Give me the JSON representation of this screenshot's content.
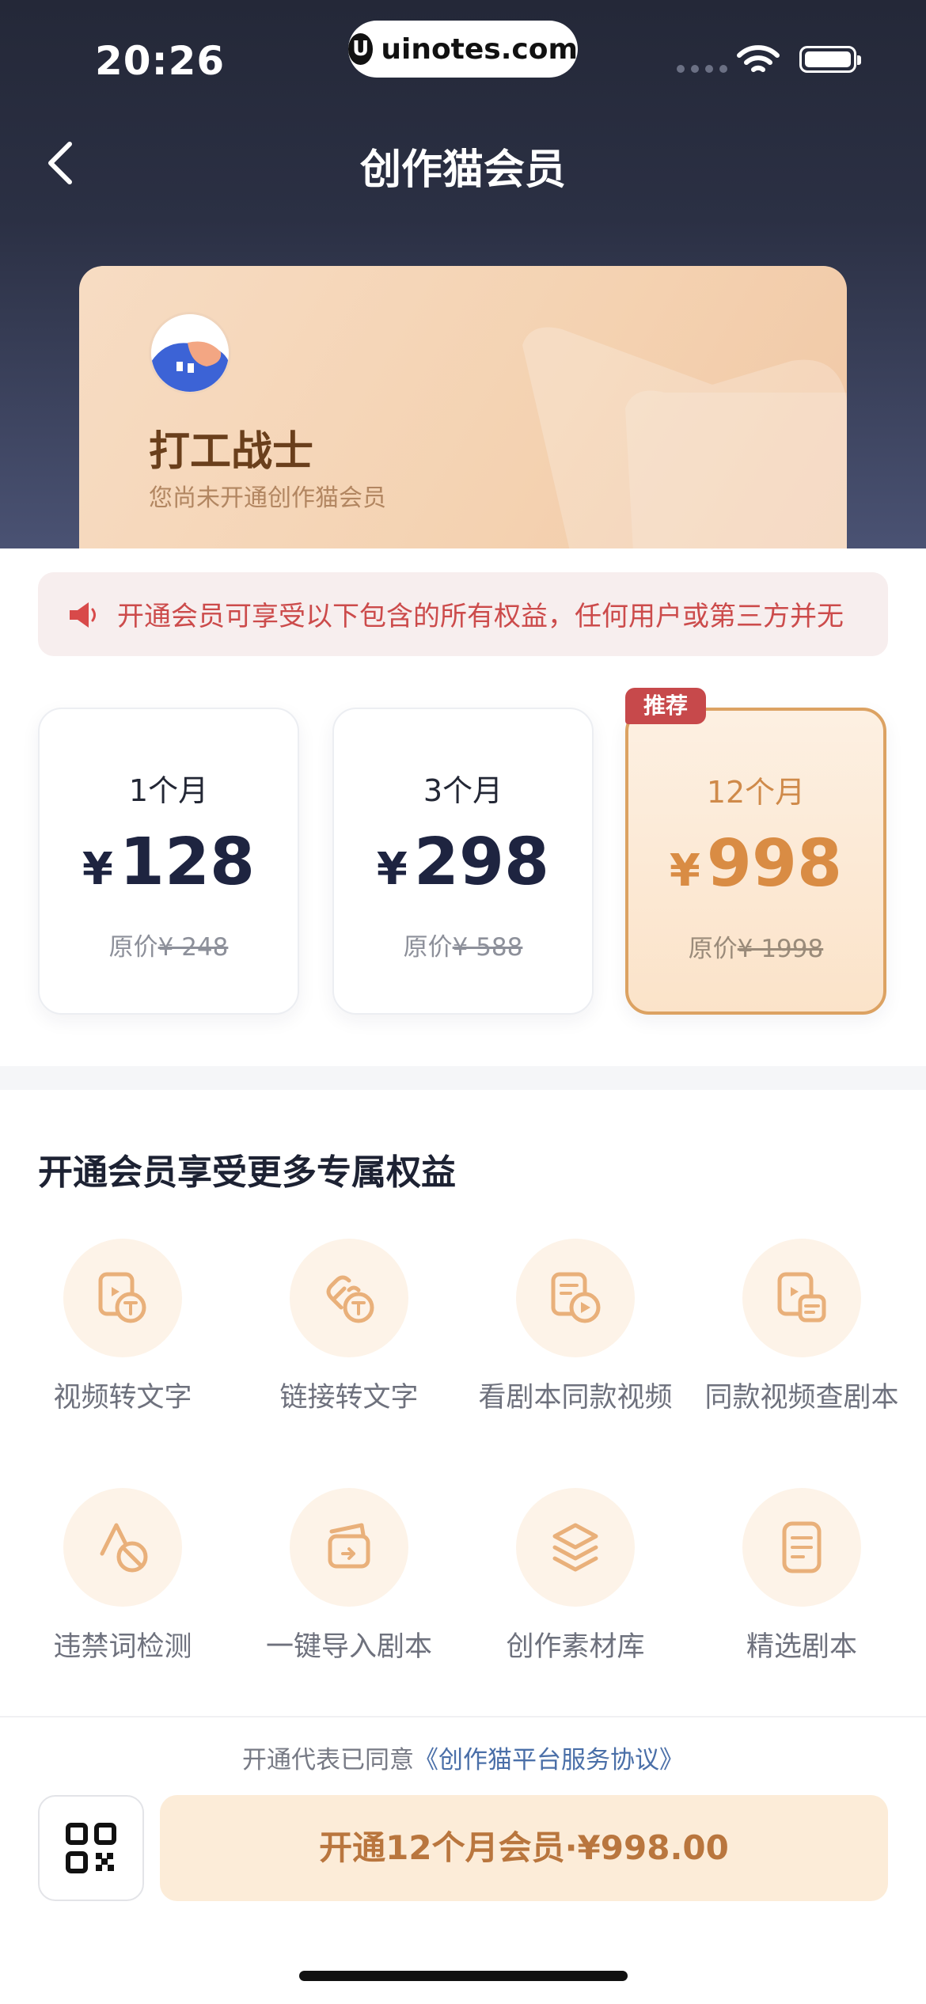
{
  "status_bar": {
    "time": "20:26",
    "site": "uinotes.com",
    "site_logo": "U"
  },
  "nav": {
    "title": "创作猫会员"
  },
  "member": {
    "name": "打工战士",
    "status": "您尚未开通创作猫会员"
  },
  "notice": {
    "text": "开通会员可享受以下包含的所有权益，任何用户或第三方并无"
  },
  "plans": [
    {
      "duration": "1个月",
      "currency": "¥",
      "price": "128",
      "original_label": "原价",
      "original_price": "¥ 248"
    },
    {
      "duration": "3个月",
      "currency": "¥",
      "price": "298",
      "original_label": "原价",
      "original_price": "¥ 588"
    },
    {
      "duration": "12个月",
      "currency": "¥",
      "price": "998",
      "original_label": "原价",
      "original_price": "¥ 1998",
      "badge": "推荐"
    }
  ],
  "benefits": {
    "title": "开通会员享受更多专属权益",
    "items": [
      {
        "label": "视频转文字",
        "icon": "video-to-text-icon"
      },
      {
        "label": "链接转文字",
        "icon": "link-to-text-icon"
      },
      {
        "label": "看剧本同款视频",
        "icon": "script-video-icon"
      },
      {
        "label": "同款视频查剧本",
        "icon": "video-script-search-icon"
      },
      {
        "label": "违禁词检测",
        "icon": "banned-word-icon"
      },
      {
        "label": "一键导入剧本",
        "icon": "import-script-icon"
      },
      {
        "label": "创作素材库",
        "icon": "material-library-icon"
      },
      {
        "label": "精选剧本",
        "icon": "featured-script-icon"
      }
    ]
  },
  "footer": {
    "agreement_prefix": "开通代表已同意",
    "agreement_link": "《创作猫平台服务协议》",
    "cta": "开通12个月会员·¥998.00"
  },
  "colors": {
    "accent": "#dca262",
    "badge": "#c7494b",
    "notice_text": "#cc4b4b",
    "cta_bg": "#fcecd8"
  }
}
